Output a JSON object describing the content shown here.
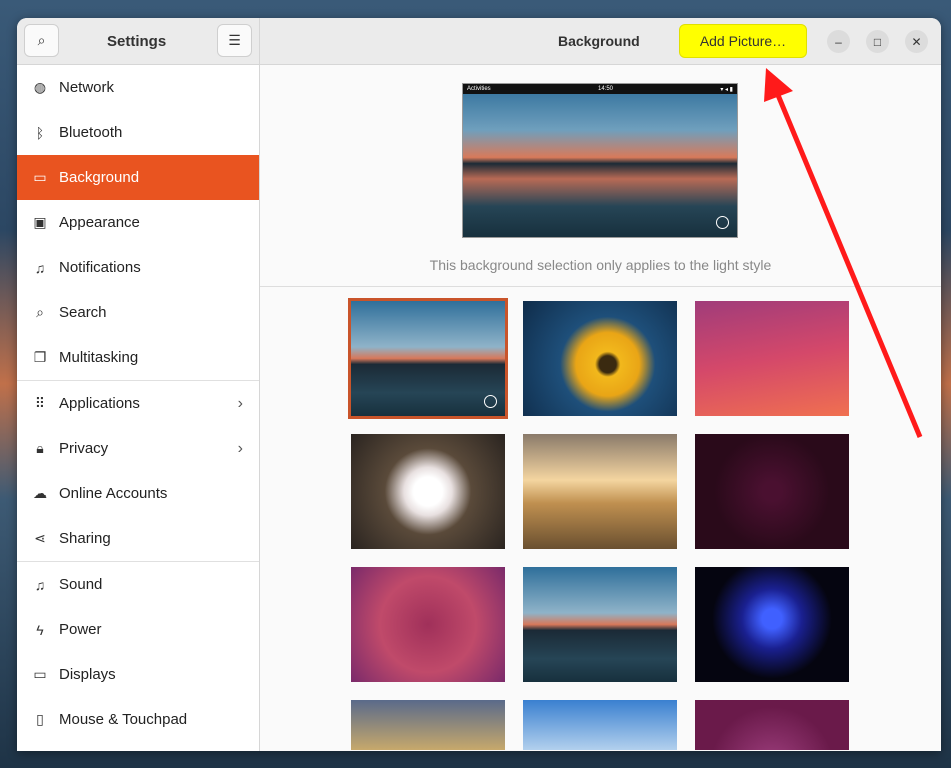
{
  "header": {
    "title": "Settings",
    "page_title": "Background",
    "add_picture": "Add Picture…"
  },
  "sidebar": {
    "items": [
      {
        "label": "Network",
        "icon": "network-icon",
        "glyph": "◍"
      },
      {
        "label": "Bluetooth",
        "icon": "bluetooth-icon",
        "glyph": "ᛒ"
      },
      {
        "label": "Background",
        "icon": "background-icon",
        "glyph": "▭"
      },
      {
        "label": "Appearance",
        "icon": "appearance-icon",
        "glyph": "▣"
      },
      {
        "label": "Notifications",
        "icon": "bell-icon",
        "glyph": "♫"
      },
      {
        "label": "Search",
        "icon": "search-icon",
        "glyph": "⌕"
      },
      {
        "label": "Multitasking",
        "icon": "multitasking-icon",
        "glyph": "❐"
      },
      {
        "label": "Applications",
        "icon": "apps-icon",
        "glyph": "⠿"
      },
      {
        "label": "Privacy",
        "icon": "lock-icon",
        "glyph": "🔒︎"
      },
      {
        "label": "Online Accounts",
        "icon": "cloud-icon",
        "glyph": "☁"
      },
      {
        "label": "Sharing",
        "icon": "share-icon",
        "glyph": "⋖"
      },
      {
        "label": "Sound",
        "icon": "music-icon",
        "glyph": "♫"
      },
      {
        "label": "Power",
        "icon": "power-icon",
        "glyph": "ϟ"
      },
      {
        "label": "Displays",
        "icon": "display-icon",
        "glyph": "▭"
      },
      {
        "label": "Mouse & Touchpad",
        "icon": "mouse-icon",
        "glyph": "▯"
      }
    ]
  },
  "preview": {
    "activities": "Activities",
    "time": "14:50"
  },
  "caption": "This background selection only applies to the light style",
  "colors": {
    "accent": "#e95420",
    "highlight": "#ffff00",
    "arrow": "#ff0000"
  }
}
